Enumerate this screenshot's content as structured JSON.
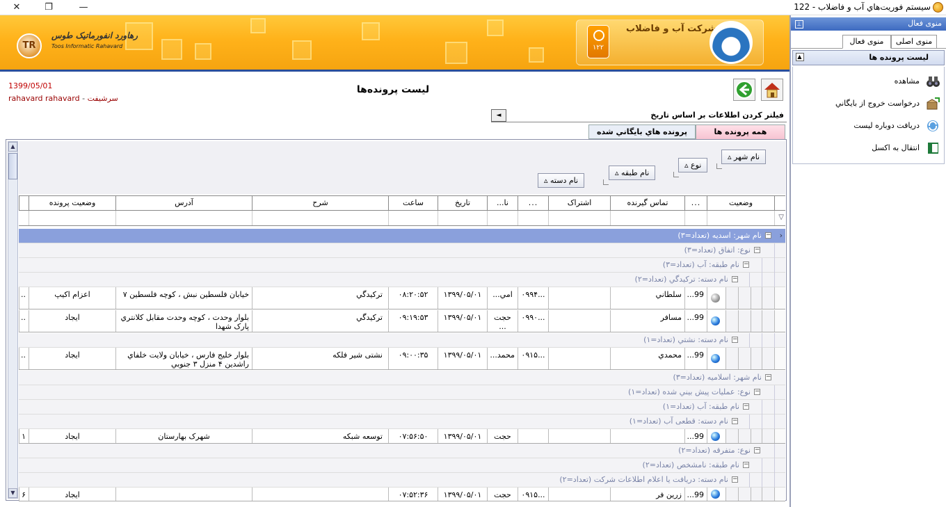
{
  "window": {
    "title": "سيستم فوريت‌هاي آب و فاضلاب - 122"
  },
  "banner": {
    "brand_fa": "رهاورد انفورماتیک طوس",
    "brand_en": "Toos Informatic Rahavard",
    "company": "شرکت آب و فاضلاب",
    "phone": "۱۲۲"
  },
  "header": {
    "date": "1399/05/01",
    "user_name": "rahavard rahavard",
    "user_role": "سرشیفت",
    "page_title": "لیست پرونده‌ها"
  },
  "filter": {
    "label": "فیلتر کردن اطلاعات بر اساس تاریخ"
  },
  "tabs": {
    "all": "همه پرونده ها",
    "archived": "پرونده هاي بايگاني شده"
  },
  "group_by": {
    "city": "نام شهر",
    "type": "نوع",
    "class": "نام طبقه",
    "category": "نام دسته",
    "sort_glyph": "▵"
  },
  "columns": {
    "status": "وضعیت",
    "dots1": "...",
    "caller": "تماس گیرنده",
    "subscription": "اشتراک",
    "dots2": "...",
    "na": "نا...",
    "date": "تاریخ",
    "time": "ساعت",
    "desc": "شرح",
    "address": "آدرس",
    "case_status": "وضعیت پرونده"
  },
  "groups": {
    "g1": "نام شهر: اسدیه (تعداد=۳)",
    "g1_type": "نوع: اتفاق (تعداد=۳)",
    "g1_class": "نام طبقه: آب (تعداد=۳)",
    "g1_cat1": "نام دسته: ترکیدگي (تعداد=۲)",
    "g1_cat2": "نام دسته: نشتي (تعداد=۱)",
    "g2": "نام شهر: اسلامیه (تعداد=۳)",
    "g2_type1": "نوع: عملیات پیش بیني شده (تعداد=۱)",
    "g2_class1": "نام طبقه: آب (تعداد=۱)",
    "g2_cat1": "نام دسته: قطعی آب (تعداد=۱)",
    "g2_type2": "نوع: متفرقه (تعداد=۲)",
    "g2_class2": "نام طبقه: نامشخص (تعداد=۲)",
    "g2_cat2": "نام دسته: دریافت یا اعلام اطلاعات شرکت (تعداد=۲)"
  },
  "rows": [
    {
      "dots1": "99...",
      "caller": "سلطاني",
      "sub": "",
      "dots2": "...۰۹۹۴",
      "na": "امي...",
      "date": "۱۳۹۹/۰۵/۰۱",
      "time": "۰۸:۲۰:۵۲",
      "desc": "ترکیدگي",
      "address": "خیابان فلسطین نبش ، کوچه فلسطین ۷",
      "case": "اعزام اکیپ",
      "last": "..",
      "icon": "gray"
    },
    {
      "dots1": "99...",
      "caller": "مسافر",
      "sub": "",
      "dots2": "...۰۹۹۰",
      "na": "حجت ...",
      "date": "۱۳۹۹/۰۵/۰۱",
      "time": "۰۹:۱۹:۵۳",
      "desc": "ترکیدگي",
      "address": "بلوار وحدت ، کوچه وحدت مقابل کلانتري پارک شهدا",
      "case": "ایجاد",
      "last": "..",
      "icon": "blue"
    },
    {
      "dots1": "99...",
      "caller": "محمدي",
      "sub": "",
      "dots2": "...۰۹۱۵",
      "na": "محمد...",
      "date": "۱۳۹۹/۰۵/۰۱",
      "time": "۰۹:۰۰:۳۵",
      "desc": "نشتی شیر فلکه",
      "address": "بلوار خلیج فارس ، خیابان ولایت خلفاي راشدین ۴ منزل ۳ جنوبي",
      "case": "ایجاد",
      "last": "..",
      "icon": "blue"
    },
    {
      "dots1": "99...",
      "caller": "",
      "sub": "",
      "dots2": "",
      "na": "حجت ...",
      "date": "۱۳۹۹/۰۵/۰۱",
      "time": "۰۷:۵۶:۵۰",
      "desc": "توسعه شبکه",
      "address": "شهرک بهارستان",
      "case": "ایجاد",
      "last": "۱",
      "icon": "blue"
    },
    {
      "dots1": "99...",
      "caller": "زرین فر",
      "sub": "",
      "dots2": "...۰۹۱۵",
      "na": "حجت ...",
      "date": "۱۳۹۹/۰۵/۰۱",
      "time": "۰۷:۵۲:۳۶",
      "desc": "",
      "address": "",
      "case": "ایجاد",
      "last": "۶",
      "icon": "blue"
    }
  ],
  "right_panel": {
    "title": "منوی فعال",
    "tab_main": "منوی اصلی",
    "tab_active": "منوی فعال",
    "list_title": "لیست پرونده ها",
    "items": [
      "مشاهده",
      "درخواست خروج از بايگاني",
      "دریافت دوباره لیست",
      "انتقال به اکسل"
    ]
  },
  "colors": {
    "accent": "#2a4e9a",
    "banner": "#ffb21a",
    "group_top": "#8aa0dc"
  }
}
